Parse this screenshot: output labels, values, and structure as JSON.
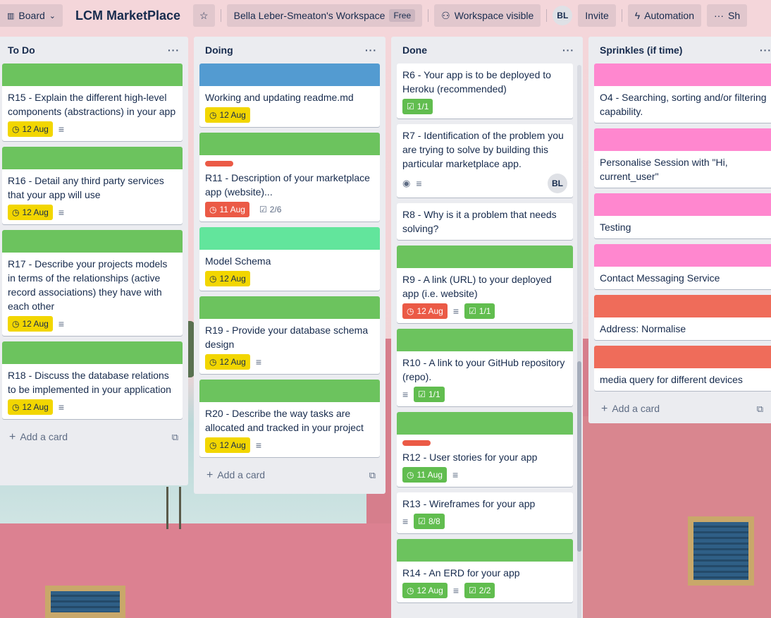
{
  "colors": {
    "green": "#61bd4f",
    "blue": "#519839",
    "teal": "#5ee8a0",
    "pink": "#ff78cb",
    "orange": "#f06b57",
    "due_yellow": "#f2d600",
    "due_red": "#eb5a46"
  },
  "header": {
    "board_view": "Board",
    "board_title": "LCM MarketPlace",
    "workspace": "Bella Leber-Smeaton's Workspace",
    "workspace_badge": "Free",
    "visibility": "Workspace visible",
    "avatar_initials": "BL",
    "invite": "Invite",
    "automation": "Automation",
    "show_menu": "Sh"
  },
  "lists": {
    "todo": {
      "title": "To Do",
      "add_card": "Add a card",
      "cards": [
        {
          "title": "R15 - Explain the different high-level components (abstractions) in your app",
          "due": "12 Aug"
        },
        {
          "title": "R16 - Detail any third party services that your app will use",
          "due": "12 Aug"
        },
        {
          "title": "R17 - Describe your projects models in terms of the relationships (active record associations) they have with each other",
          "due": "12 Aug"
        },
        {
          "title": "R18 - Discuss the database relations to be implemented in your application",
          "due": "12 Aug"
        }
      ]
    },
    "doing": {
      "title": "Doing",
      "add_card": "Add a card",
      "cards": [
        {
          "title": "Working and updating readme.md",
          "due": "12 Aug"
        },
        {
          "title": "R11 - Description of your marketplace app (website)...",
          "due": "11 Aug",
          "checklist": "2/6"
        },
        {
          "title": "Model Schema",
          "due": "12 Aug"
        },
        {
          "title": "R19 - Provide your database schema design",
          "due": "12 Aug"
        },
        {
          "title": "R20 - Describe the way tasks are allocated and tracked in your project",
          "due": "12 Aug"
        }
      ]
    },
    "done": {
      "title": "Done",
      "cards": [
        {
          "title": "R6 - Your app is to be deployed to Heroku (recommended)",
          "checklist": "1/1"
        },
        {
          "title": "R7 - Identification of the problem you are trying to solve by building this particular marketplace app.",
          "avatar": "BL"
        },
        {
          "title": "R8 - Why is it a problem that needs solving?"
        },
        {
          "title": "R9 - A link (URL) to your deployed app (i.e. website)",
          "due": "12 Aug",
          "checklist": "1/1"
        },
        {
          "title": "R10 - A link to your GitHub repository (repo).",
          "checklist": "1/1"
        },
        {
          "title": "R12 - User stories for your app",
          "due": "11 Aug"
        },
        {
          "title": "R13 - Wireframes for your app",
          "checklist": "8/8"
        },
        {
          "title": "R14 - An ERD for your app",
          "due": "12 Aug",
          "checklist": "2/2"
        }
      ]
    },
    "sprinkles": {
      "title": "Sprinkles (if time)",
      "add_card": "Add a card",
      "cards": [
        {
          "title": "O4 - Searching, sorting and/or filtering capability."
        },
        {
          "title": "Personalise Session with \"Hi, current_user\""
        },
        {
          "title": "Testing"
        },
        {
          "title": "Contact Messaging Service"
        },
        {
          "title": "Address: Normalise"
        },
        {
          "title": "media query for different devices"
        }
      ]
    }
  }
}
